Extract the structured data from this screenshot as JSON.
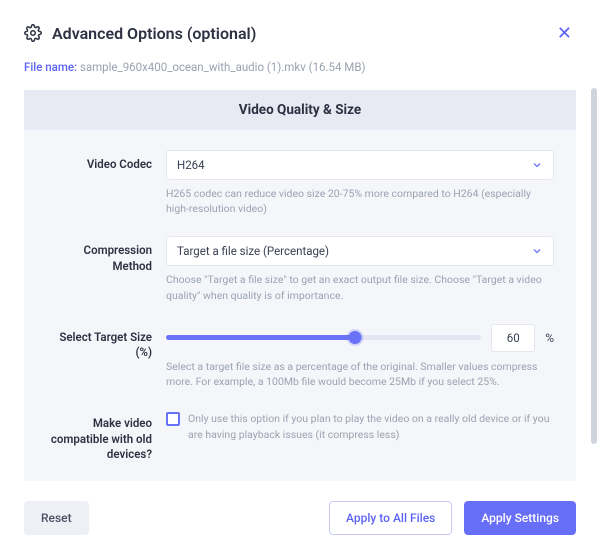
{
  "header": {
    "title": "Advanced Options (optional)"
  },
  "file": {
    "label": "File name: ",
    "value": "sample_960x400_ocean_with_audio (1).mkv (16.54 MB)"
  },
  "panel": {
    "title": "Video Quality & Size"
  },
  "form": {
    "codec": {
      "label": "Video Codec",
      "selected": "H264",
      "hint": "H265 codec can reduce video size 20-75% more compared to H264 (especially high-resolution video)"
    },
    "compression": {
      "label": "Compression Method",
      "selected": "Target a file size (Percentage)",
      "hint": "Choose \"Target a file size\" to get an exact output file size. Choose \"Target a video quality\" when quality is of importance."
    },
    "target_size": {
      "label": "Select Target Size (%)",
      "value": "60",
      "unit": "%",
      "hint": "Select a target file size as a percentage of the original. Smaller values compress more. For example, a 100Mb file would become 25Mb if you select 25%."
    },
    "compat": {
      "label": "Make video compatible with old devices?",
      "checked": false,
      "text": "Only use this option if you plan to play the video on a really old device or if you are having playback issues (it compress less)"
    }
  },
  "footer": {
    "reset": "Reset",
    "apply_all": "Apply to All Files",
    "apply": "Apply Settings"
  }
}
